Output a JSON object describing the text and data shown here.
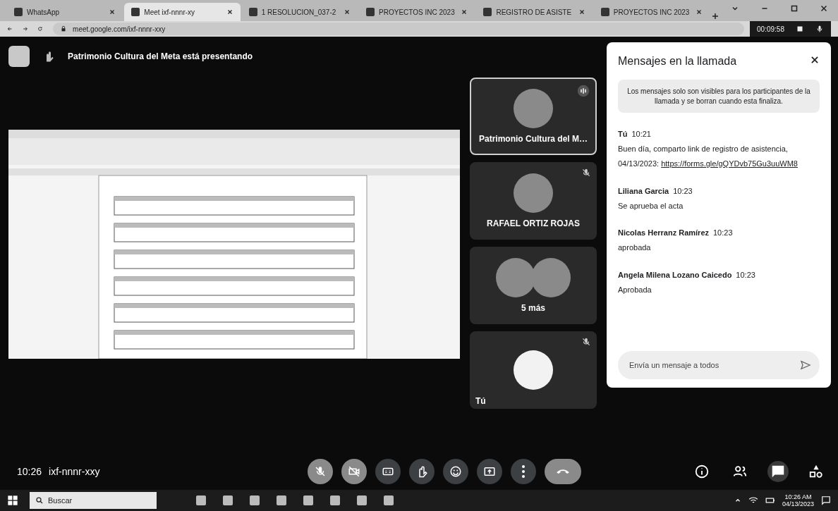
{
  "browser": {
    "tabs": [
      {
        "title": "WhatsApp",
        "selected": false
      },
      {
        "title": "Meet ixf-nnnr-xy",
        "selected": true
      },
      {
        "title": "1 RESOLUCION_037-2",
        "selected": false
      },
      {
        "title": "PROYECTOS INC 2023",
        "selected": false
      },
      {
        "title": "REGISTRO DE ASISTE",
        "selected": false
      },
      {
        "title": "PROYECTOS INC 2023",
        "selected": false
      }
    ],
    "address": "meet.google.com/ixf-nnnr-xxy",
    "timer": "00:09:58"
  },
  "presenting_banner": "Patrimonio Cultura del Meta está presentando",
  "tiles": [
    {
      "kind": "person",
      "name": "Patrimonio Cultura del M…",
      "speaking": true,
      "muted": false
    },
    {
      "kind": "person",
      "name": "RAFAEL ORTIZ ROJAS",
      "speaking": false,
      "muted": true
    },
    {
      "kind": "group",
      "name": "5 más",
      "speaking": false,
      "muted": false
    },
    {
      "kind": "logo",
      "name": "Tú",
      "speaking": false,
      "muted": true
    }
  ],
  "chat": {
    "title": "Mensajes en la llamada",
    "notice": "Los mensajes solo son visibles para los participantes de la llamada y se borran cuando esta finaliza.",
    "messages": [
      {
        "sender": "Tú",
        "time": "10:21",
        "text": "Buen día, comparto link de registro de asistencia, 04/13/2023:",
        "link": "https://forms.gle/gQYDvb75Gu3uuWM8"
      },
      {
        "sender": "Liliana Garcia",
        "time": "10:23",
        "text": "Se aprueba el acta"
      },
      {
        "sender": "Nicolas Herranz Ramírez",
        "time": "10:23",
        "text": "aprobada"
      },
      {
        "sender": "Angela Milena Lozano Caicedo",
        "time": "10:23",
        "text": "Aprobada"
      }
    ],
    "placeholder": "Envía un mensaje a todos"
  },
  "meeting_bar": {
    "time": "10:26",
    "code": "ixf-nnnr-xxy",
    "controls": [
      {
        "kind": "mic"
      },
      {
        "kind": "camera"
      },
      {
        "kind": "captions"
      },
      {
        "kind": "hand"
      },
      {
        "kind": "emoji"
      },
      {
        "kind": "present"
      },
      {
        "kind": "more"
      },
      {
        "kind": "hangup"
      }
    ],
    "side": [
      {
        "kind": "info",
        "selected": false
      },
      {
        "kind": "people",
        "selected": false
      },
      {
        "kind": "chat",
        "selected": true
      },
      {
        "kind": "activities",
        "selected": false
      }
    ]
  },
  "taskbar": {
    "placeholder": "Buscar",
    "time": "10:26 AM",
    "date": "04/13/2023"
  }
}
